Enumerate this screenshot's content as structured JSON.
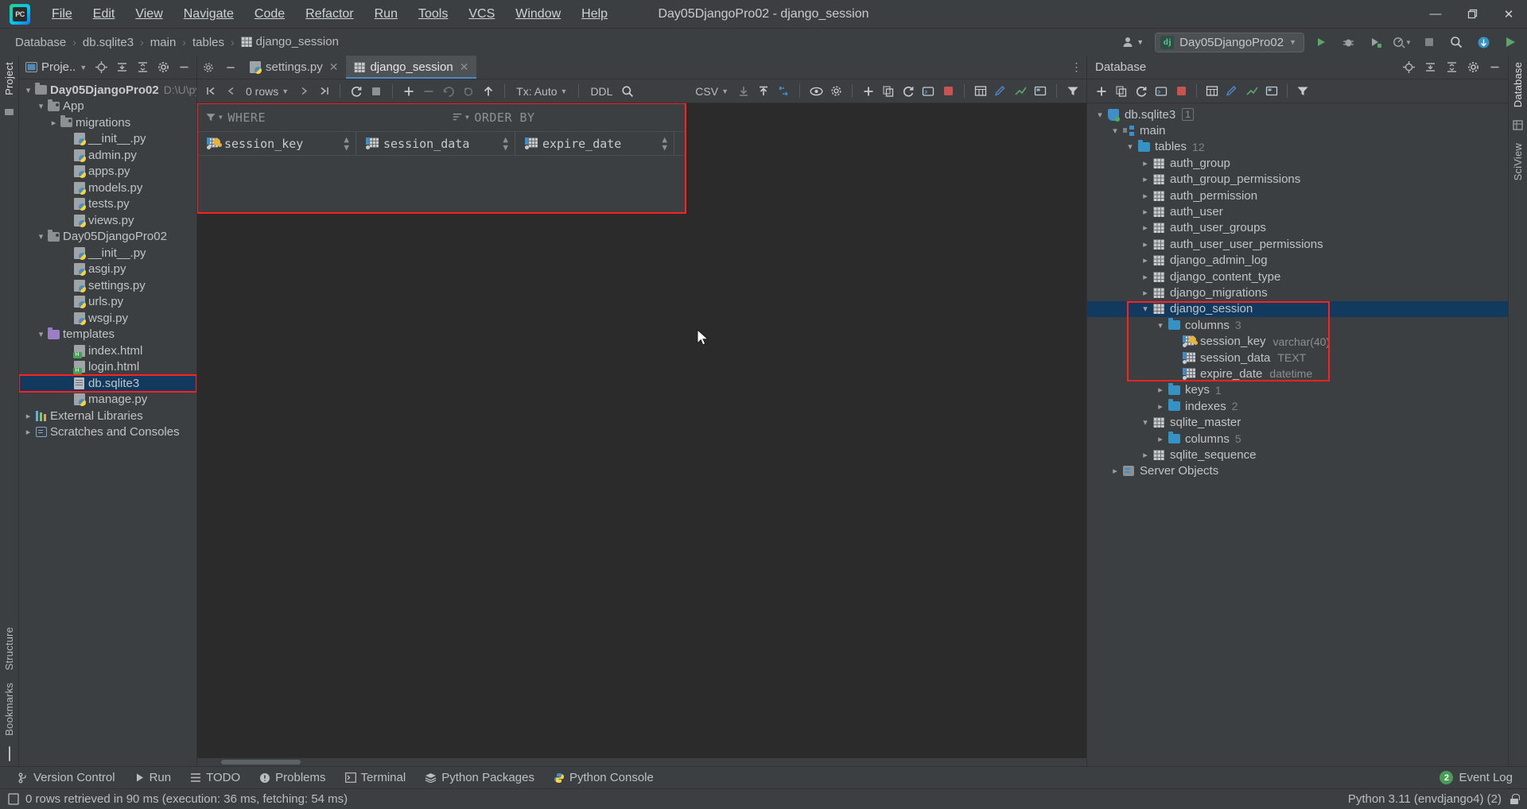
{
  "window": {
    "title": "Day05DjangoPro02 - django_session",
    "menu": [
      "File",
      "Edit",
      "View",
      "Navigate",
      "Code",
      "Refactor",
      "Run",
      "Tools",
      "VCS",
      "Window",
      "Help"
    ],
    "controls": {
      "minimize": "—",
      "maximize": "❐",
      "close": "✕"
    }
  },
  "breadcrumb": {
    "items": [
      "Database",
      "db.sqlite3",
      "main",
      "tables",
      "django_session"
    ],
    "separator": "›"
  },
  "nav_right": {
    "run_config": "Day05DjangoPro02",
    "dj_icon_label": "dj",
    "icons": [
      "user-icon",
      "run-icon",
      "debug-icon",
      "coverage-icon",
      "profile-icon",
      "stop-icon",
      "search-icon",
      "update-icon",
      "ide-icon"
    ]
  },
  "project_panel": {
    "title": "Proje..",
    "toolbar_icons": [
      "locate-icon",
      "expand-all-icon",
      "collapse-all-icon",
      "settings-gear-icon",
      "hide-icon"
    ],
    "tree": [
      {
        "label": "Day05DjangoPro02",
        "note": "D:\\U\\pyth",
        "depth": 0,
        "icon": "folder",
        "arrow": "down",
        "bold": true
      },
      {
        "label": "App",
        "depth": 1,
        "icon": "folder-module",
        "arrow": "down"
      },
      {
        "label": "migrations",
        "depth": 2,
        "icon": "folder-module",
        "arrow": "right"
      },
      {
        "label": "__init__.py",
        "depth": 3,
        "icon": "python-file"
      },
      {
        "label": "admin.py",
        "depth": 3,
        "icon": "python-file"
      },
      {
        "label": "apps.py",
        "depth": 3,
        "icon": "python-file"
      },
      {
        "label": "models.py",
        "depth": 3,
        "icon": "python-file"
      },
      {
        "label": "tests.py",
        "depth": 3,
        "icon": "python-file"
      },
      {
        "label": "views.py",
        "depth": 3,
        "icon": "python-file"
      },
      {
        "label": "Day05DjangoPro02",
        "depth": 1,
        "icon": "folder-module",
        "arrow": "down"
      },
      {
        "label": "__init__.py",
        "depth": 3,
        "icon": "python-file"
      },
      {
        "label": "asgi.py",
        "depth": 3,
        "icon": "python-file"
      },
      {
        "label": "settings.py",
        "depth": 3,
        "icon": "python-file"
      },
      {
        "label": "urls.py",
        "depth": 3,
        "icon": "python-file"
      },
      {
        "label": "wsgi.py",
        "depth": 3,
        "icon": "python-file"
      },
      {
        "label": "templates",
        "depth": 1,
        "icon": "folder-template",
        "arrow": "down"
      },
      {
        "label": "index.html",
        "depth": 3,
        "icon": "html-file"
      },
      {
        "label": "login.html",
        "depth": 3,
        "icon": "html-file"
      },
      {
        "label": "db.sqlite3",
        "depth": 3,
        "icon": "db-file",
        "selected": true,
        "highlighted": true
      },
      {
        "label": "manage.py",
        "depth": 3,
        "icon": "python-file"
      },
      {
        "label": "External Libraries",
        "depth": 0,
        "icon": "library",
        "arrow": "right"
      },
      {
        "label": "Scratches and Consoles",
        "depth": 0,
        "icon": "scratch",
        "arrow": "right"
      }
    ]
  },
  "left_strip": {
    "labels": [
      "Project",
      "Structure",
      "Bookmarks"
    ]
  },
  "right_strip": {
    "labels": [
      "Database",
      "SciView"
    ]
  },
  "editor": {
    "tabs": [
      {
        "label": "settings.py",
        "icon": "python-file",
        "active": false,
        "close": "✕"
      },
      {
        "label": "django_session",
        "icon": "table-icon",
        "active": true,
        "close": "✕"
      }
    ],
    "more": "⋮"
  },
  "data_toolbar": {
    "row_count": "0 rows",
    "tx": "Tx: Auto",
    "ddl": "DDL",
    "format": "CSV",
    "nav": [
      "first-page-icon",
      "prev-page-icon",
      "next-page-icon",
      "last-page-icon"
    ],
    "actions": [
      "refresh-icon",
      "stop-icon",
      "add-row-icon",
      "delete-row-icon",
      "revert-icon",
      "revert-selected-icon",
      "submit-icon",
      "search-icon",
      "import-icon",
      "export-icon",
      "compare-icon",
      "preview-icon",
      "settings-icon"
    ]
  },
  "filter_panel": {
    "where_label": "WHERE",
    "where_icon": "filter-icon",
    "order_by_label": "ORDER BY",
    "order_by_icon": "sort-icon",
    "columns": [
      {
        "name": "session_key",
        "icon": "primary-key-column-icon",
        "sort": "↕"
      },
      {
        "name": "session_data",
        "icon": "column-icon",
        "sort": "↕"
      },
      {
        "name": "expire_date",
        "icon": "column-icon",
        "sort": "↕"
      }
    ],
    "highlighted": true
  },
  "db_panel": {
    "title": "Database",
    "header_icons": [
      "locate-icon",
      "expand-all-icon",
      "collapse-all-icon",
      "settings-gear-icon",
      "hide-icon"
    ],
    "toolbar_icons": [
      "add-icon",
      "duplicate-icon",
      "refresh-icon",
      "jump-to-console-icon",
      "stop-icon",
      "table-editor-icon",
      "modify-icon",
      "forward-engineer-icon",
      "diagram-icon",
      "filter-icon"
    ],
    "tree": [
      {
        "label": "db.sqlite3",
        "depth": 0,
        "icon": "sqlite-db-icon",
        "arrow": "down",
        "badge": "1"
      },
      {
        "label": "main",
        "depth": 1,
        "icon": "schema-icon",
        "arrow": "down"
      },
      {
        "label": "tables",
        "depth": 2,
        "icon": "folder-blue",
        "arrow": "down",
        "count": "12"
      },
      {
        "label": "auth_group",
        "depth": 3,
        "icon": "table-icon",
        "arrow": "right"
      },
      {
        "label": "auth_group_permissions",
        "depth": 3,
        "icon": "table-icon",
        "arrow": "right"
      },
      {
        "label": "auth_permission",
        "depth": 3,
        "icon": "table-icon",
        "arrow": "right"
      },
      {
        "label": "auth_user",
        "depth": 3,
        "icon": "table-icon",
        "arrow": "right"
      },
      {
        "label": "auth_user_groups",
        "depth": 3,
        "icon": "table-icon",
        "arrow": "right"
      },
      {
        "label": "auth_user_user_permissions",
        "depth": 3,
        "icon": "table-icon",
        "arrow": "right"
      },
      {
        "label": "django_admin_log",
        "depth": 3,
        "icon": "table-icon",
        "arrow": "right"
      },
      {
        "label": "django_content_type",
        "depth": 3,
        "icon": "table-icon",
        "arrow": "right"
      },
      {
        "label": "django_migrations",
        "depth": 3,
        "icon": "table-icon",
        "arrow": "right"
      },
      {
        "label": "django_session",
        "depth": 3,
        "icon": "table-icon",
        "arrow": "down",
        "selected": true
      },
      {
        "label": "columns",
        "depth": 4,
        "icon": "folder-blue",
        "arrow": "down",
        "count": "3"
      },
      {
        "label": "session_key",
        "depth": 5,
        "icon": "primary-key-column-icon",
        "type": "varchar(40)"
      },
      {
        "label": "session_data",
        "depth": 5,
        "icon": "column-icon",
        "type": "TEXT"
      },
      {
        "label": "expire_date",
        "depth": 5,
        "icon": "column-icon",
        "type": "datetime"
      },
      {
        "label": "keys",
        "depth": 4,
        "icon": "folder-blue",
        "arrow": "right",
        "count": "1"
      },
      {
        "label": "indexes",
        "depth": 4,
        "icon": "folder-blue",
        "arrow": "right",
        "count": "2"
      },
      {
        "label": "sqlite_master",
        "depth": 3,
        "icon": "table-icon",
        "arrow": "down"
      },
      {
        "label": "columns",
        "depth": 4,
        "icon": "folder-blue",
        "arrow": "right",
        "count": "5"
      },
      {
        "label": "sqlite_sequence",
        "depth": 3,
        "icon": "table-icon",
        "arrow": "right"
      },
      {
        "label": "Server Objects",
        "depth": 1,
        "icon": "server-objects-icon",
        "arrow": "right"
      }
    ]
  },
  "tool_window_bar": {
    "items": [
      {
        "label": "Version Control",
        "icon": "branch-icon"
      },
      {
        "label": "Run",
        "icon": "play-icon"
      },
      {
        "label": "TODO",
        "icon": "list-icon"
      },
      {
        "label": "Problems",
        "icon": "warning-icon"
      },
      {
        "label": "Terminal",
        "icon": "terminal-icon"
      },
      {
        "label": "Python Packages",
        "icon": "packages-icon"
      },
      {
        "label": "Python Console",
        "icon": "python-icon"
      }
    ],
    "event_log": {
      "label": "Event Log",
      "count": "2"
    }
  },
  "status_bar": {
    "message": "0 rows retrieved in 90 ms (execution: 36 ms, fetching: 54 ms)",
    "interpreter": "Python 3.11 (envdjango4) (2)",
    "lock_icon": "unlocked-icon"
  }
}
